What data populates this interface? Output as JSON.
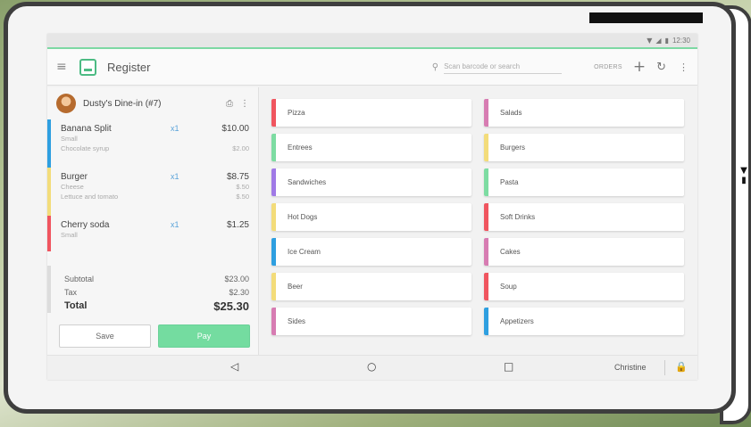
{
  "device": {
    "edge_glyph": "▼\n▮"
  },
  "status_bar": {
    "icons": [
      "wifi-icon",
      "signal-icon",
      "battery-icon"
    ],
    "wifi_glyph": "▼",
    "signal_glyph": "◢",
    "battery_glyph": "▮",
    "time": "12:30"
  },
  "app_bar": {
    "menu_glyph": "≡",
    "title": "Register",
    "search_glyph": "⚲",
    "search_placeholder": "Scan barcode or search",
    "orders_label": "ORDERS",
    "plus_glyph": "+",
    "refresh_glyph": "↻",
    "more_glyph": "⋮"
  },
  "order": {
    "name": "Dusty's Dine-in (#7)",
    "print_glyph": "⎙",
    "more_glyph": "⋮",
    "items": [
      {
        "name": "Banana Split",
        "qty": "x1",
        "price": "$10.00",
        "color": "#2e9fe0",
        "mods": [
          {
            "name": "Small",
            "price": ""
          },
          {
            "name": "Chocolate syrup",
            "price": "$2.00"
          }
        ]
      },
      {
        "name": "Burger",
        "qty": "x1",
        "price": "$8.75",
        "color": "#f3dc7a",
        "mods": [
          {
            "name": "Cheese",
            "price": "$.50"
          },
          {
            "name": "Lettuce and tomato",
            "price": "$.50"
          }
        ]
      },
      {
        "name": "Cherry soda",
        "qty": "x1",
        "price": "$1.25",
        "color": "#f0555f",
        "mods": [
          {
            "name": "Small",
            "price": ""
          }
        ]
      }
    ],
    "subtotal_label": "Subtotal",
    "subtotal": "$23.00",
    "tax_label": "Tax",
    "tax": "$2.30",
    "total_label": "Total",
    "total": "$25.30",
    "save_label": "Save",
    "pay_label": "Pay"
  },
  "categories": [
    {
      "name": "Pizza",
      "color": "#f0555f"
    },
    {
      "name": "Salads",
      "color": "#d77cb2"
    },
    {
      "name": "Entrees",
      "color": "#7ddca2"
    },
    {
      "name": "Burgers",
      "color": "#f3dc7a"
    },
    {
      "name": "Sandwiches",
      "color": "#a07ae6"
    },
    {
      "name": "Pasta",
      "color": "#7ddca2"
    },
    {
      "name": "Hot Dogs",
      "color": "#f3dc7a"
    },
    {
      "name": "Soft Drinks",
      "color": "#f0555f"
    },
    {
      "name": "Ice Cream",
      "color": "#2e9fe0"
    },
    {
      "name": "Cakes",
      "color": "#d77cb2"
    },
    {
      "name": "Beer",
      "color": "#f3dc7a"
    },
    {
      "name": "Soup",
      "color": "#f0555f"
    },
    {
      "name": "Sides",
      "color": "#d77cb2"
    },
    {
      "name": "Appetizers",
      "color": "#2e9fe0"
    }
  ],
  "nav_bar": {
    "back_glyph": "◁",
    "home_glyph": "○",
    "recents_glyph": "□",
    "user_name": "Christine",
    "lock_glyph": "🔒"
  },
  "colors": {
    "accent_green": "#4cbb83",
    "pay_button": "#74dca0",
    "qty_blue": "#5aa3d9"
  }
}
